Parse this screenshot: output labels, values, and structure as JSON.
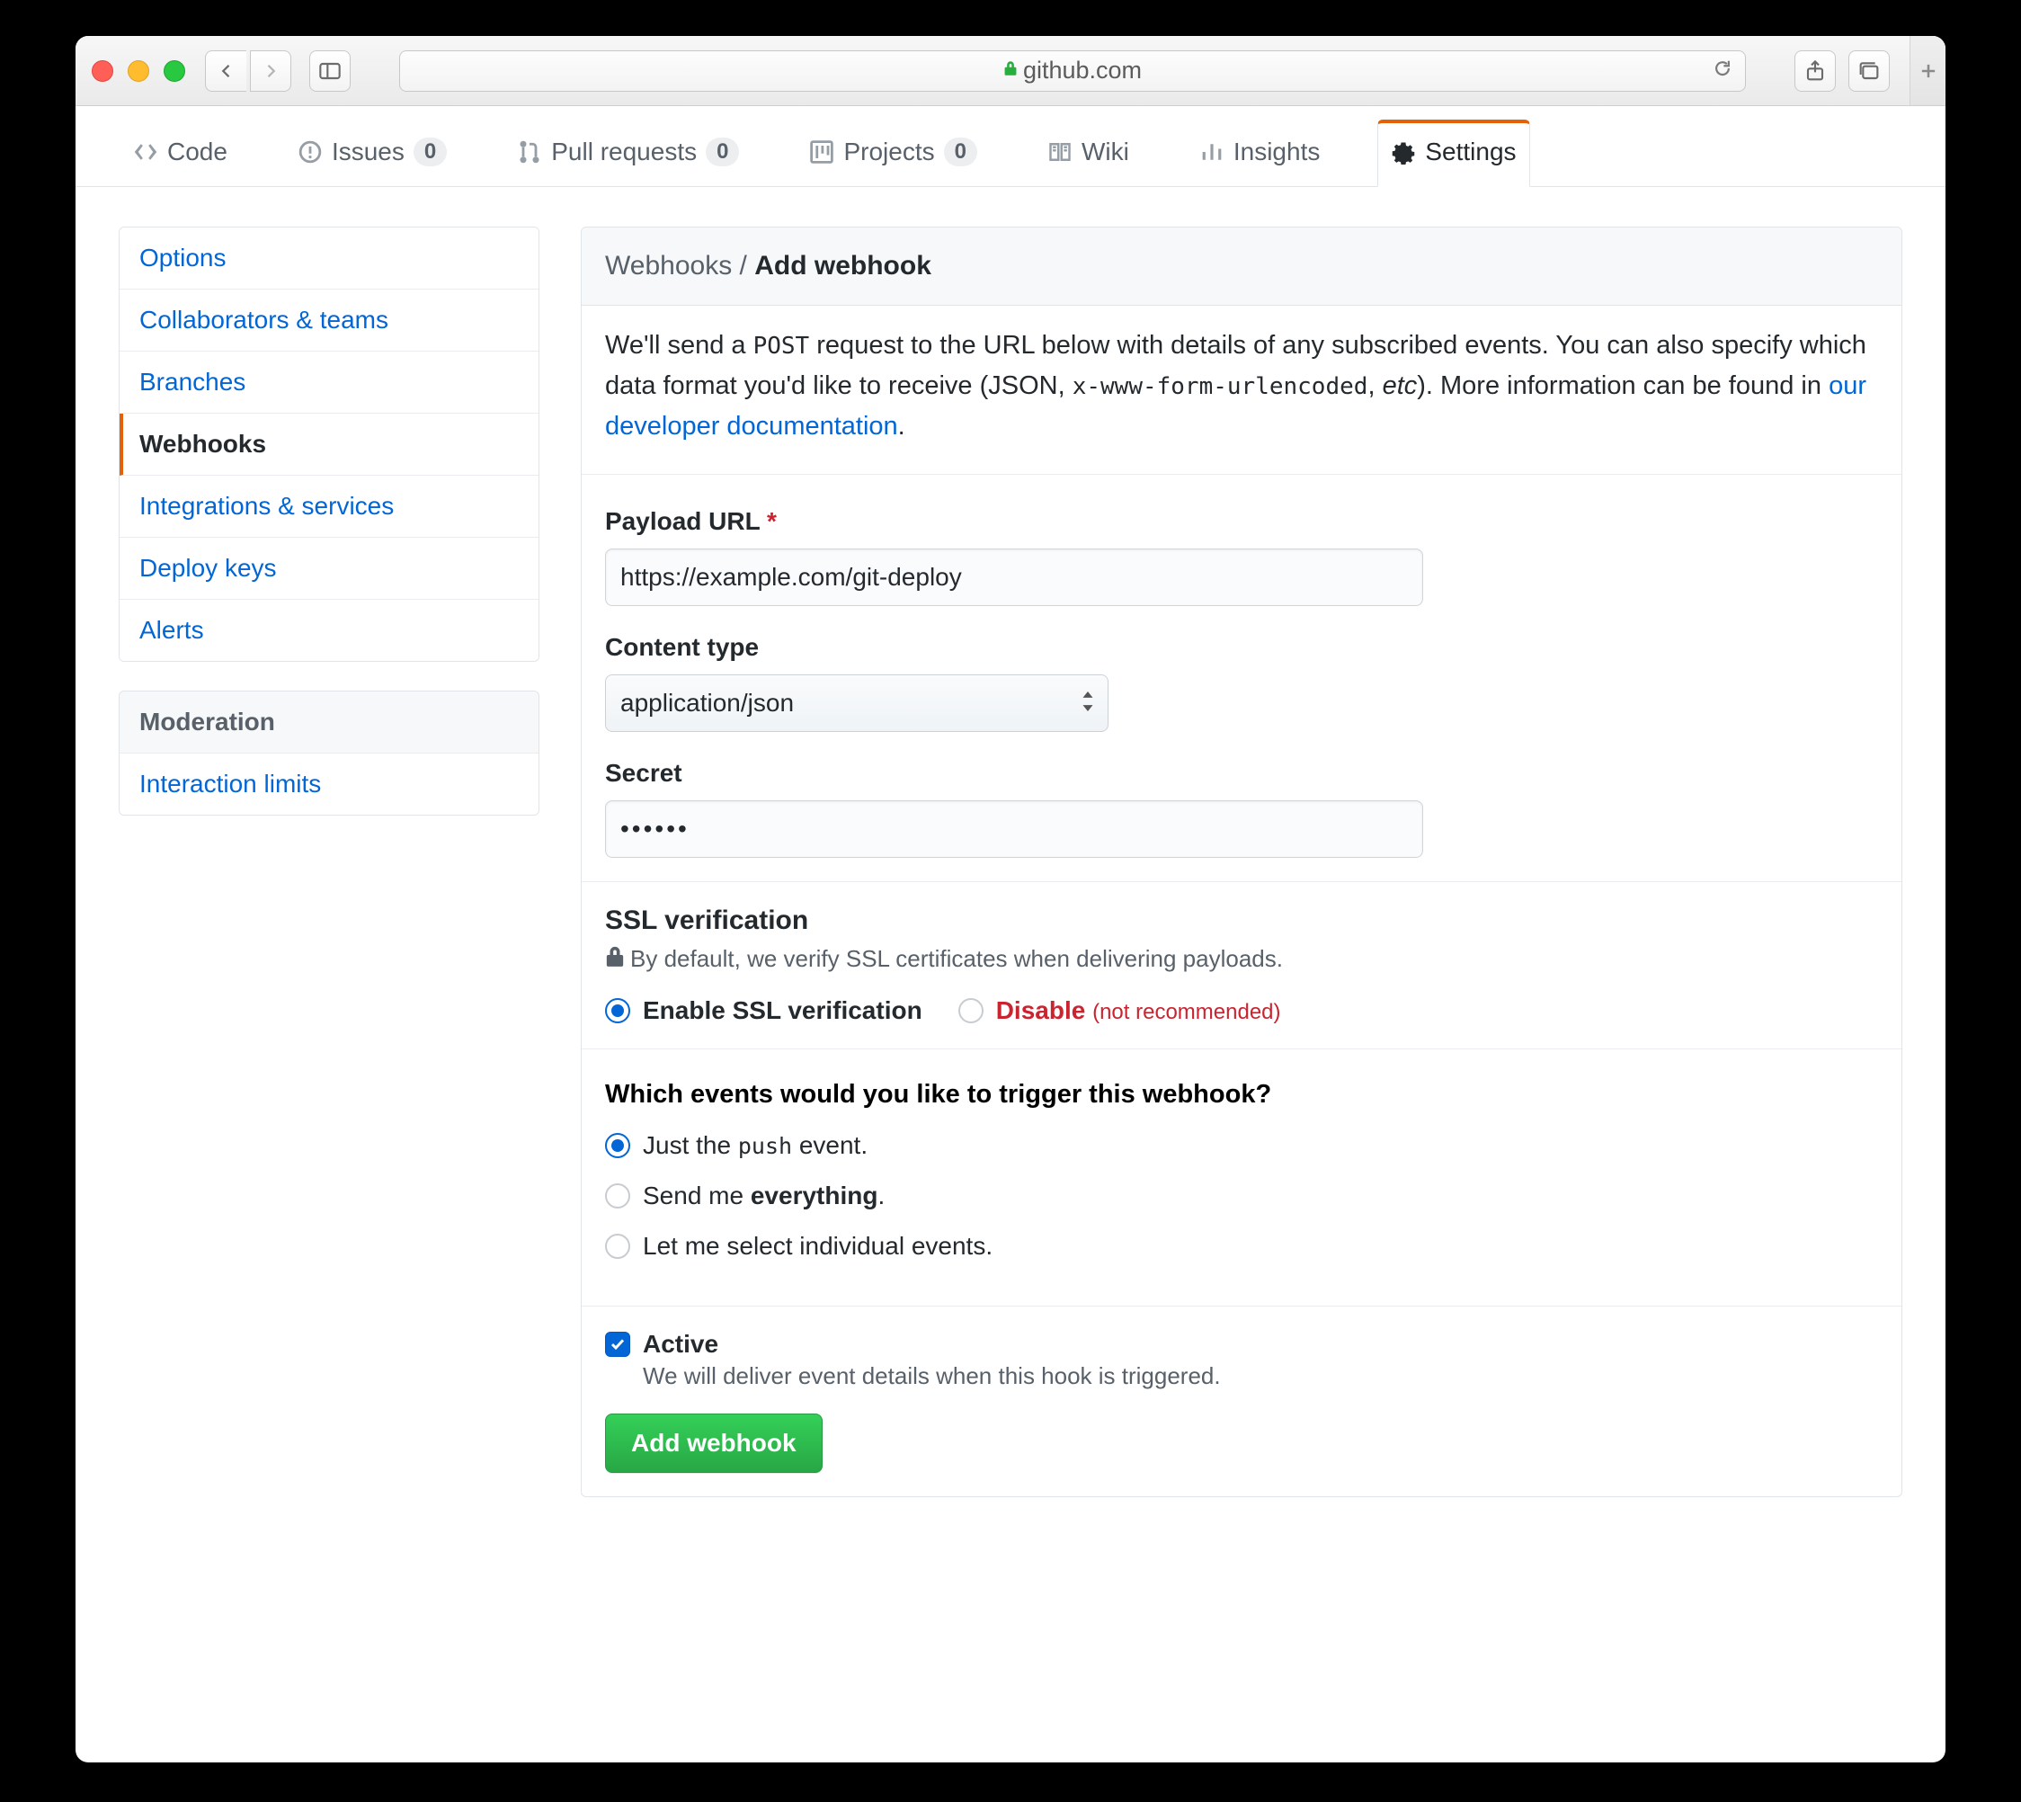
{
  "browser": {
    "domain": "github.com"
  },
  "tabs": {
    "code": "Code",
    "issues": "Issues",
    "issues_count": "0",
    "pulls": "Pull requests",
    "pulls_count": "0",
    "projects": "Projects",
    "projects_count": "0",
    "wiki": "Wiki",
    "insights": "Insights",
    "settings": "Settings"
  },
  "sidebar": {
    "items": [
      {
        "label": "Options"
      },
      {
        "label": "Collaborators & teams"
      },
      {
        "label": "Branches"
      },
      {
        "label": "Webhooks"
      },
      {
        "label": "Integrations & services"
      },
      {
        "label": "Deploy keys"
      },
      {
        "label": "Alerts"
      }
    ],
    "moderation_header": "Moderation",
    "moderation_items": [
      {
        "label": "Interaction limits"
      }
    ]
  },
  "main": {
    "breadcrumb_parent": "Webhooks",
    "breadcrumb_current": "Add webhook",
    "intro_1": "We'll send a ",
    "intro_post": "POST",
    "intro_2": " request to the URL below with details of any subscribed events. You can also specify which data format you'd like to receive (JSON, ",
    "intro_xform": "x-www-form-urlencoded",
    "intro_3": ", ",
    "intro_etc": "etc",
    "intro_4": "). More information can be found in ",
    "intro_link": "our developer documentation",
    "intro_5": ".",
    "payload_label": "Payload URL",
    "payload_value": "https://example.com/git-deploy",
    "content_type_label": "Content type",
    "content_type_value": "application/json",
    "secret_label": "Secret",
    "secret_value": "••••••",
    "ssl_header": "SSL verification",
    "ssl_note": "By default, we verify SSL certificates when delivering payloads.",
    "ssl_enable": "Enable SSL verification",
    "ssl_disable": "Disable",
    "ssl_disable_note": "(not recommended)",
    "events_question": "Which events would you like to trigger this webhook?",
    "event_push_1": "Just the ",
    "event_push_code": "push",
    "event_push_2": " event.",
    "event_everything_1": "Send me ",
    "event_everything_bold": "everything",
    "event_everything_2": ".",
    "event_individual": "Let me select individual events.",
    "active_label": "Active",
    "active_note": "We will deliver event details when this hook is triggered.",
    "submit": "Add webhook"
  }
}
